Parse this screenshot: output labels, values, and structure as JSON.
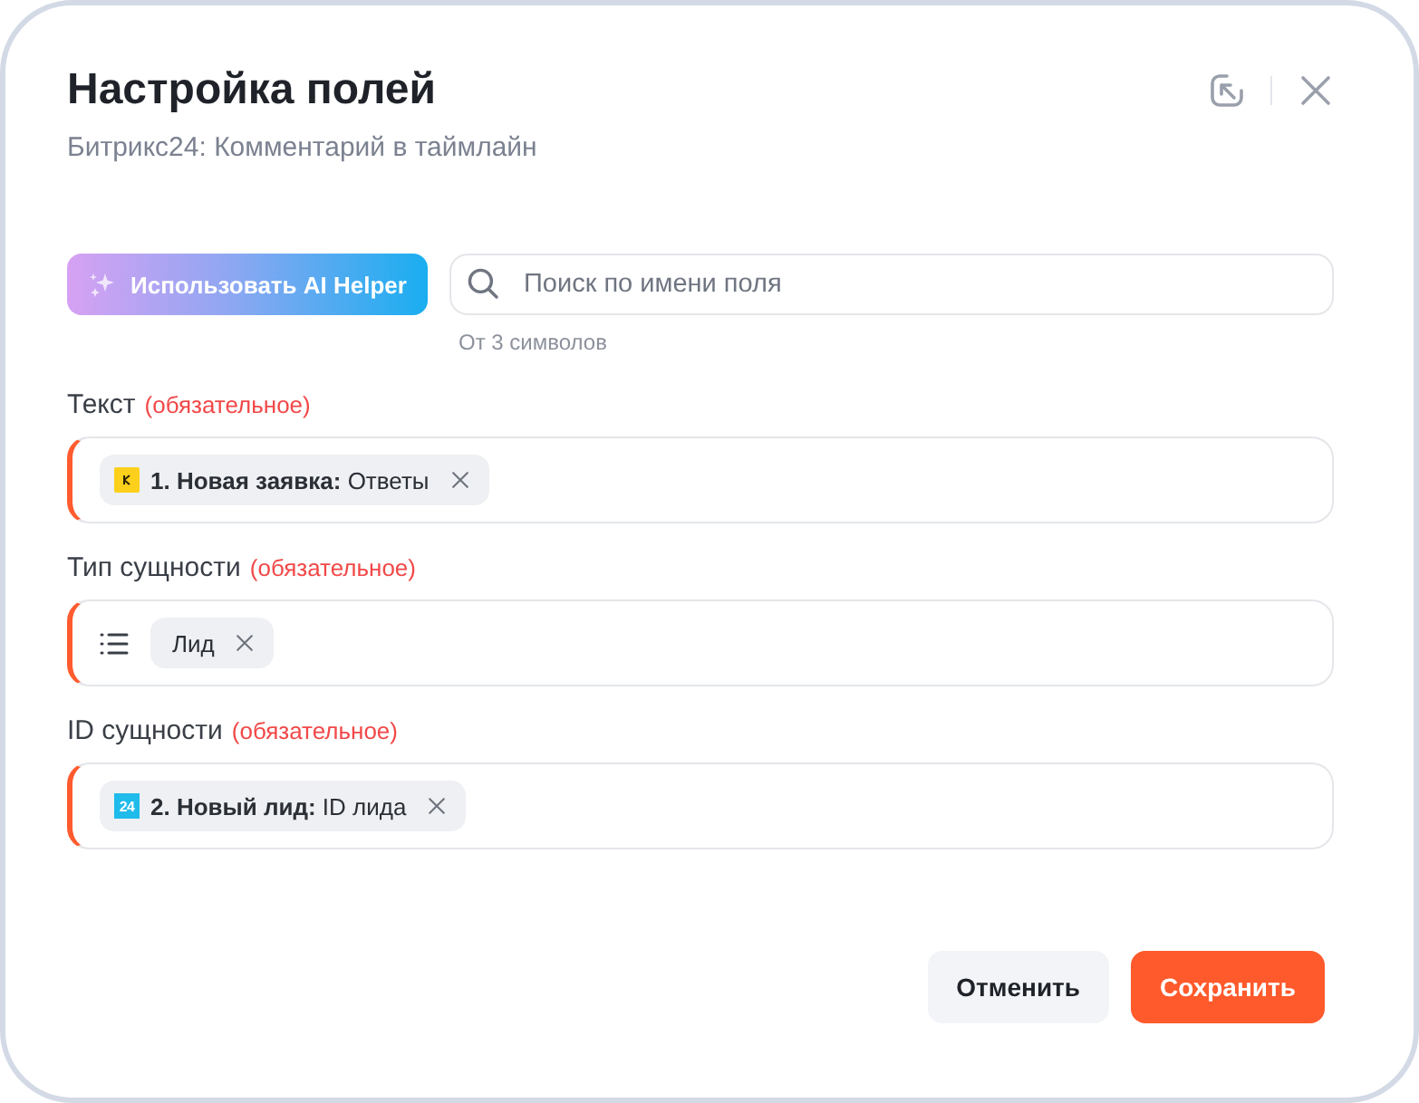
{
  "dialog": {
    "title": "Настройка полей",
    "subtitle": "Битрикс24: Комментарий в таймлайн"
  },
  "ai_button": {
    "label": "Использовать AI Helper"
  },
  "search": {
    "placeholder": "Поиск по имени поля",
    "hint": "От 3 символов"
  },
  "fields": [
    {
      "label": "Текст",
      "required_note": "(обязательное)",
      "required": true,
      "kind": "text",
      "chips": [
        {
          "kind": "step",
          "text": "**1. Новая заявка:** Ответы",
          "color": "#fcd01b"
        }
      ]
    },
    {
      "label": "Тип сущности",
      "required_note": "(обязательное)",
      "required": true,
      "kind": "select",
      "chips": [
        {
          "kind": "value",
          "text": "Лид"
        }
      ]
    },
    {
      "label": "ID сущности",
      "required_note": "(обязательное)",
      "required": true,
      "kind": "text",
      "chips": [
        {
          "kind": "step",
          "text": "**2. Новый лид:** ID лида",
          "color": "#1fbbea",
          "badge_text": "24"
        }
      ]
    }
  ],
  "buttons": [
    {
      "label": "Отменить",
      "kind": "secondary"
    },
    {
      "label": "Сохранить",
      "kind": "primary"
    }
  ]
}
